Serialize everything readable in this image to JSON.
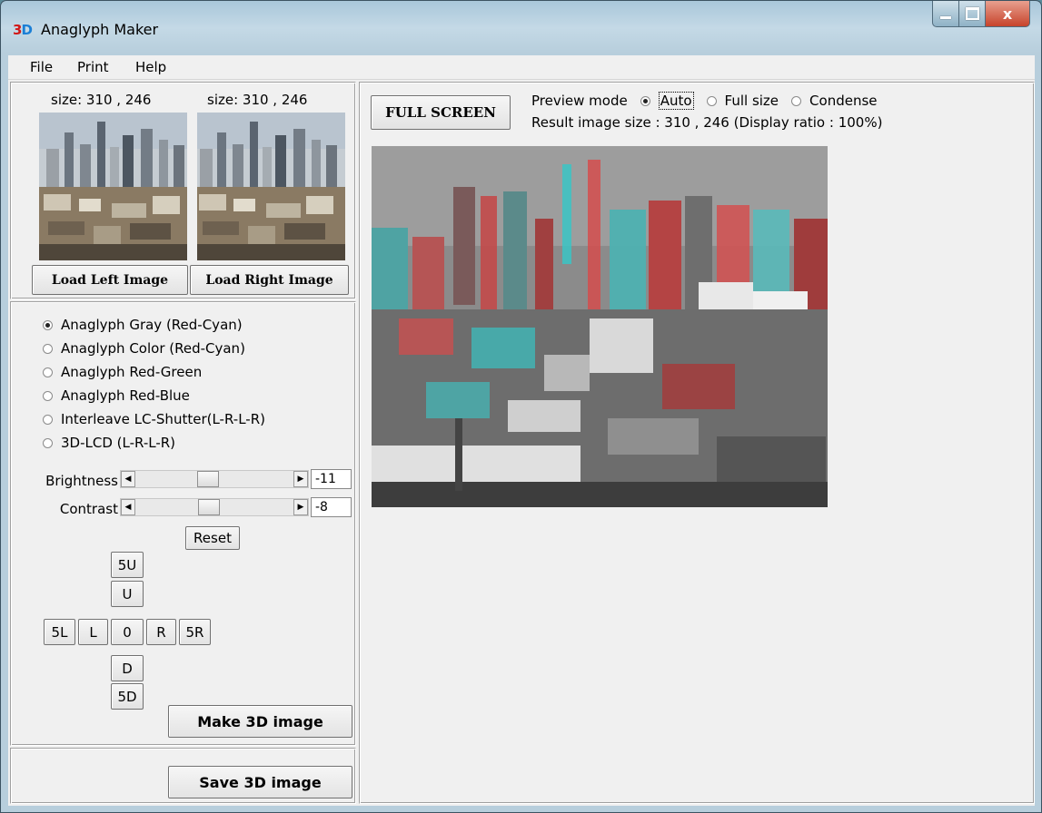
{
  "window": {
    "title": "Anaglyph Maker",
    "icon_label_3": "3",
    "icon_label_d": "D",
    "close_glyph": "x"
  },
  "menu": {
    "file": "File",
    "print": "Print",
    "help": "Help"
  },
  "left_panel": {
    "left_size": "size: 310 , 246",
    "right_size": "size: 310 , 246",
    "load_left": "Load Left Image",
    "load_right": "Load Right Image"
  },
  "modes": [
    {
      "label": "Anaglyph Gray (Red-Cyan)",
      "selected": true
    },
    {
      "label": "Anaglyph Color (Red-Cyan)",
      "selected": false
    },
    {
      "label": "Anaglyph Red-Green",
      "selected": false
    },
    {
      "label": "Anaglyph Red-Blue",
      "selected": false
    },
    {
      "label": "Interleave LC-Shutter(L-R-L-R)",
      "selected": false
    },
    {
      "label": "3D-LCD (L-R-L-R)",
      "selected": false
    }
  ],
  "adjust": {
    "brightness_label": "Brightness",
    "brightness_value": "-11",
    "brightness_level": 0.45,
    "contrast_label": "Contrast",
    "contrast_value": "-8",
    "contrast_level": 0.46,
    "reset": "Reset"
  },
  "shift": {
    "up5": "5U",
    "up": "U",
    "left5": "5L",
    "left": "L",
    "center": "0",
    "right": "R",
    "right5": "5R",
    "down": "D",
    "down5": "5D"
  },
  "actions": {
    "make": "Make 3D image",
    "save": "Save 3D image"
  },
  "preview": {
    "full_screen": "FULL SCREEN",
    "mode_label": "Preview mode",
    "options": [
      "Auto",
      "Full size",
      "Condense"
    ],
    "selected": "Auto",
    "result_text": "Result image size :  310 , 246  (Display ratio : 100%)"
  },
  "colors": {
    "title_gradient": "#a9c7da",
    "client_bg": "#f0f0f0",
    "close_red": "#c7432b"
  }
}
